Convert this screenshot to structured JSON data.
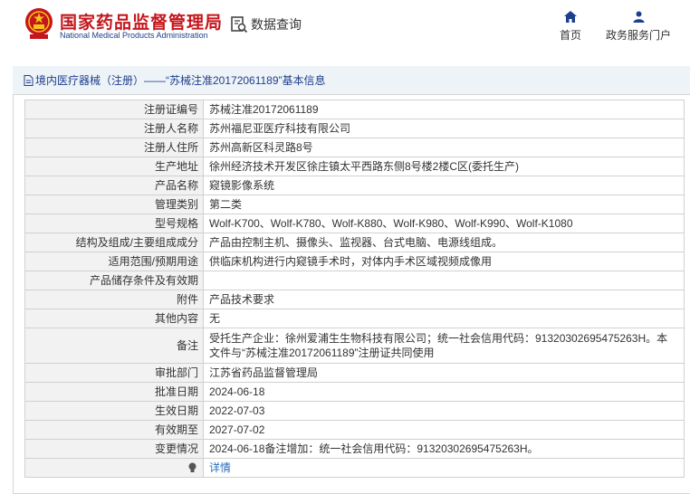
{
  "header": {
    "org_cn": "国家药品监督管理局",
    "org_en": "National Medical Products Administration",
    "query_label": "数据查询",
    "nav_home": "首页",
    "nav_gov": "政务服务门户"
  },
  "breadcrumb": {
    "text": "境内医疗器械（注册）——“苏械注准20172061189”基本信息"
  },
  "rows": [
    {
      "label": "注册证编号",
      "value": "苏械注准20172061189"
    },
    {
      "label": "注册人名称",
      "value": "苏州福尼亚医疗科技有限公司"
    },
    {
      "label": "注册人住所",
      "value": "苏州高新区科灵路8号"
    },
    {
      "label": "生产地址",
      "value": "徐州经济技术开发区徐庄镇太平西路东侧8号楼2楼C区(委托生产)"
    },
    {
      "label": "产品名称",
      "value": "窥镜影像系统"
    },
    {
      "label": "管理类别",
      "value": "第二类"
    },
    {
      "label": "型号规格",
      "value": "Wolf-K700、Wolf-K780、Wolf-K880、Wolf-K980、Wolf-K990、Wolf-K1080"
    },
    {
      "label": "结构及组成/主要组成成分",
      "value": "产品由控制主机、摄像头、监视器、台式电脑、电源线组成。"
    },
    {
      "label": "适用范围/预期用途",
      "value": "供临床机构进行内窥镜手术时，对体内手术区域视频成像用"
    },
    {
      "label": "产品储存条件及有效期",
      "value": ""
    },
    {
      "label": "附件",
      "value": "产品技术要求"
    },
    {
      "label": "其他内容",
      "value": "无"
    },
    {
      "label": "备注",
      "value": "受托生产企业：徐州爱浦生生物科技有限公司；统一社会信用代码：91320302695475263H。本文件与“苏械注准20172061189”注册证共同使用"
    },
    {
      "label": "审批部门",
      "value": "江苏省药品监督管理局"
    },
    {
      "label": "批准日期",
      "value": "2024-06-18"
    },
    {
      "label": "生效日期",
      "value": "2022-07-03"
    },
    {
      "label": "有效期至",
      "value": "2027-07-02"
    },
    {
      "label": "变更情况",
      "value": "2024-06-18备注增加：统一社会信用代码：91320302695475263H。"
    }
  ],
  "detail_link": "详情",
  "colors": {
    "brand_red": "#c4161c",
    "brand_blue": "#1d3f8c",
    "link": "#2a6ebb"
  }
}
